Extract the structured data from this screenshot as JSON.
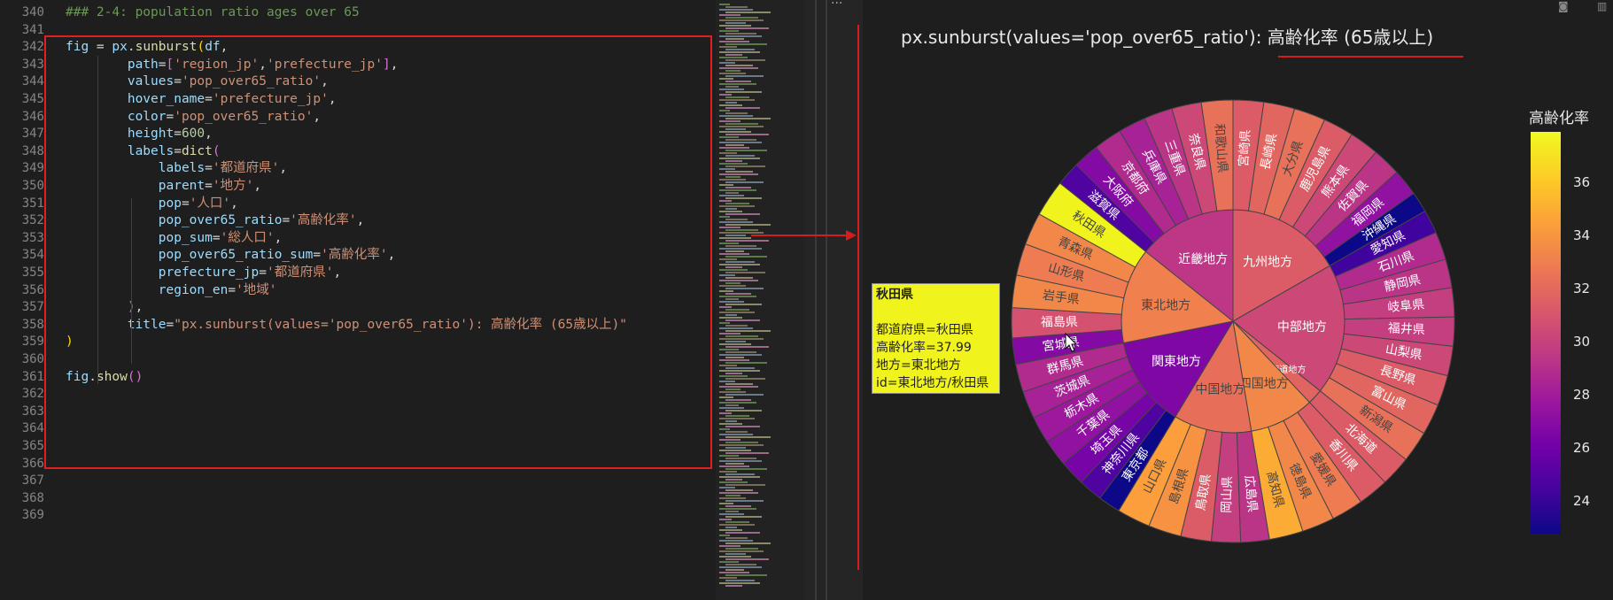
{
  "editor": {
    "line_numbers": [
      "340",
      "341",
      "342",
      "343",
      "344",
      "345",
      "346",
      "347",
      "348",
      "349",
      "350",
      "351",
      "352",
      "353",
      "354",
      "355",
      "356",
      "357",
      "358",
      "359",
      "360",
      "361",
      "362",
      "363",
      "364",
      "365",
      "366",
      "367",
      "368",
      "369"
    ],
    "lines": [
      [
        {
          "t": "### 2-4: population ratio ages over 65",
          "c": "com"
        }
      ],
      [],
      [
        {
          "t": "fig",
          "c": "var"
        },
        {
          "t": " = ",
          "c": "punc"
        },
        {
          "t": "px",
          "c": "var"
        },
        {
          "t": ".",
          "c": "punc"
        },
        {
          "t": "sunburst",
          "c": "fn"
        },
        {
          "t": "(",
          "c": "b1"
        },
        {
          "t": "df",
          "c": "var"
        },
        {
          "t": ",",
          "c": "punc"
        }
      ],
      [
        {
          "t": "        path",
          "c": "var"
        },
        {
          "t": "=",
          "c": "punc"
        },
        {
          "t": "[",
          "c": "b2"
        },
        {
          "t": "'region_jp'",
          "c": "str"
        },
        {
          "t": ",",
          "c": "punc"
        },
        {
          "t": "'prefecture_jp'",
          "c": "str"
        },
        {
          "t": "]",
          "c": "b2"
        },
        {
          "t": ",",
          "c": "punc"
        }
      ],
      [
        {
          "t": "        values",
          "c": "var"
        },
        {
          "t": "=",
          "c": "punc"
        },
        {
          "t": "'pop_over65_ratio'",
          "c": "str"
        },
        {
          "t": ",",
          "c": "punc"
        }
      ],
      [
        {
          "t": "        hover_name",
          "c": "var"
        },
        {
          "t": "=",
          "c": "punc"
        },
        {
          "t": "'prefecture_jp'",
          "c": "str"
        },
        {
          "t": ",",
          "c": "punc"
        }
      ],
      [
        {
          "t": "        color",
          "c": "var"
        },
        {
          "t": "=",
          "c": "punc"
        },
        {
          "t": "'pop_over65_ratio'",
          "c": "str"
        },
        {
          "t": ",",
          "c": "punc"
        }
      ],
      [
        {
          "t": "        height",
          "c": "var"
        },
        {
          "t": "=",
          "c": "punc"
        },
        {
          "t": "600",
          "c": "num"
        },
        {
          "t": ",",
          "c": "punc"
        }
      ],
      [
        {
          "t": "        labels",
          "c": "var"
        },
        {
          "t": "=",
          "c": "punc"
        },
        {
          "t": "dict",
          "c": "fn"
        },
        {
          "t": "(",
          "c": "b2"
        }
      ],
      [
        {
          "t": "            labels",
          "c": "var"
        },
        {
          "t": "=",
          "c": "punc"
        },
        {
          "t": "'都道府県'",
          "c": "str"
        },
        {
          "t": ",",
          "c": "punc"
        }
      ],
      [
        {
          "t": "            parent",
          "c": "var"
        },
        {
          "t": "=",
          "c": "punc"
        },
        {
          "t": "'地方'",
          "c": "str"
        },
        {
          "t": ",",
          "c": "punc"
        }
      ],
      [
        {
          "t": "            pop",
          "c": "var"
        },
        {
          "t": "=",
          "c": "punc"
        },
        {
          "t": "'人口'",
          "c": "str"
        },
        {
          "t": ",",
          "c": "punc"
        }
      ],
      [
        {
          "t": "            pop_over65_ratio",
          "c": "var"
        },
        {
          "t": "=",
          "c": "punc"
        },
        {
          "t": "'高齢化率'",
          "c": "str"
        },
        {
          "t": ",",
          "c": "punc"
        }
      ],
      [
        {
          "t": "            pop_sum",
          "c": "var"
        },
        {
          "t": "=",
          "c": "punc"
        },
        {
          "t": "'総人口'",
          "c": "str"
        },
        {
          "t": ",",
          "c": "punc"
        }
      ],
      [
        {
          "t": "            pop_over65_ratio_sum",
          "c": "var"
        },
        {
          "t": "=",
          "c": "punc"
        },
        {
          "t": "'高齢化率'",
          "c": "str"
        },
        {
          "t": ",",
          "c": "punc"
        }
      ],
      [
        {
          "t": "            prefecture_jp",
          "c": "var"
        },
        {
          "t": "=",
          "c": "punc"
        },
        {
          "t": "'都道府県'",
          "c": "str"
        },
        {
          "t": ",",
          "c": "punc"
        }
      ],
      [
        {
          "t": "            region_en",
          "c": "var"
        },
        {
          "t": "=",
          "c": "punc"
        },
        {
          "t": "'地域'",
          "c": "str"
        }
      ],
      [
        {
          "t": "        ",
          "c": "punc"
        },
        {
          "t": ")",
          "c": "b2"
        },
        {
          "t": ",",
          "c": "punc"
        }
      ],
      [
        {
          "t": "        title",
          "c": "var"
        },
        {
          "t": "=",
          "c": "punc"
        },
        {
          "t": "\"px.sunburst(values='pop_over65_ratio'): 高齢化率 (65歳以上)\"",
          "c": "str"
        }
      ],
      [
        {
          "t": ")",
          "c": "b1"
        }
      ],
      [],
      [
        {
          "t": "fig",
          "c": "var"
        },
        {
          "t": ".",
          "c": "punc"
        },
        {
          "t": "show",
          "c": "fn"
        },
        {
          "t": "()",
          "c": "b2"
        }
      ],
      [],
      [],
      [],
      [],
      [],
      [],
      [],
      []
    ]
  },
  "chart": {
    "title": "px.sunburst(values='pop_over65_ratio'): 高齢化率 (65歳以上)",
    "colorbar_title": "高齢化率",
    "colorbar_ticks": [
      "36",
      "34",
      "32",
      "30",
      "28",
      "26",
      "24"
    ],
    "tooltip": {
      "head": "秋田県",
      "lines": [
        "都道府県=秋田県",
        "高齢化率=37.99",
        "地方=東北地方",
        "id=東北地方/秋田県"
      ]
    },
    "colors": {
      "highlight": "#f0f31c",
      "low": "#0d0887",
      "high": "#f0f921"
    }
  },
  "chart_data": {
    "type": "sunburst",
    "title": "px.sunburst(values='pop_over65_ratio'): 高齢化率 (65歳以上)",
    "colorbar": {
      "title": "高齢化率",
      "range": [
        23,
        38
      ],
      "ticks": [
        24,
        26,
        28,
        30,
        32,
        34,
        36
      ]
    },
    "regions": [
      {
        "name": "九州地方",
        "value": 31.0,
        "color_value": 31.5
      },
      {
        "name": "中部地方",
        "value": 29.5,
        "color_value": 30.5
      },
      {
        "name": "北海道地方",
        "value": 3.0,
        "color_value": 31.9
      },
      {
        "name": "四国地方",
        "value": 13.0,
        "color_value": 33.5
      },
      {
        "name": "中国地方",
        "value": 18.0,
        "color_value": 32.4
      },
      {
        "name": "関東地方",
        "value": 13.0,
        "color_value": 26.8
      },
      {
        "name": "東北地方",
        "value": 20.0,
        "color_value": 33.2
      },
      {
        "name": "近畿地方",
        "value": 20.5,
        "color_value": 29.6
      }
    ],
    "prefectures": [
      {
        "name": "宮崎県",
        "region": "九州地方",
        "value": 31.5
      },
      {
        "name": "長崎県",
        "region": "九州地方",
        "value": 32.0
      },
      {
        "name": "大分県",
        "region": "九州地方",
        "value": 32.5
      },
      {
        "name": "鹿児島県",
        "region": "九州地方",
        "value": 31.5
      },
      {
        "name": "熊本県",
        "region": "九州地方",
        "value": 30.5
      },
      {
        "name": "佐賀県",
        "region": "九州地方",
        "value": 29.5
      },
      {
        "name": "福岡県",
        "region": "九州地方",
        "value": 27.5
      },
      {
        "name": "沖縄県",
        "region": "九州地方",
        "value": 21.5
      },
      {
        "name": "愛知県",
        "region": "中部地方",
        "value": 24.5
      },
      {
        "name": "石川県",
        "region": "中部地方",
        "value": 29.0
      },
      {
        "name": "静岡県",
        "region": "中部地方",
        "value": 29.5
      },
      {
        "name": "岐阜県",
        "region": "中部地方",
        "value": 30.0
      },
      {
        "name": "福井県",
        "region": "中部地方",
        "value": 30.0
      },
      {
        "name": "山梨県",
        "region": "中部地方",
        "value": 30.5
      },
      {
        "name": "長野県",
        "region": "中部地方",
        "value": 31.5
      },
      {
        "name": "富山県",
        "region": "中部地方",
        "value": 32.0
      },
      {
        "name": "新潟県",
        "region": "中部地方",
        "value": 32.5
      },
      {
        "name": "北海道",
        "region": "北海道地方",
        "value": 31.5
      },
      {
        "name": "香川県",
        "region": "四国地方",
        "value": 31.5
      },
      {
        "name": "愛媛県",
        "region": "四国地方",
        "value": 33.0
      },
      {
        "name": "徳島県",
        "region": "四国地方",
        "value": 33.5
      },
      {
        "name": "高知県",
        "region": "四国地方",
        "value": 35.0
      },
      {
        "name": "広島県",
        "region": "中国地方",
        "value": 29.5
      },
      {
        "name": "岡山県",
        "region": "中国地方",
        "value": 30.0
      },
      {
        "name": "鳥取県",
        "region": "中国地方",
        "value": 31.5
      },
      {
        "name": "島根県",
        "region": "中国地方",
        "value": 34.0
      },
      {
        "name": "山口県",
        "region": "中国地方",
        "value": 34.5
      },
      {
        "name": "東京都",
        "region": "関東地方",
        "value": 23.0
      },
      {
        "name": "神奈川県",
        "region": "関東地方",
        "value": 25.0
      },
      {
        "name": "埼玉県",
        "region": "関東地方",
        "value": 26.5
      },
      {
        "name": "千葉県",
        "region": "関東地方",
        "value": 27.5
      },
      {
        "name": "栃木県",
        "region": "関東地方",
        "value": 28.0
      },
      {
        "name": "茨城県",
        "region": "関東地方",
        "value": 28.5
      },
      {
        "name": "群馬県",
        "region": "関東地方",
        "value": 29.0
      },
      {
        "name": "宮城県",
        "region": "東北地方",
        "value": 27.0
      },
      {
        "name": "福島県",
        "region": "東北地方",
        "value": 31.0
      },
      {
        "name": "岩手県",
        "region": "東北地方",
        "value": 33.5
      },
      {
        "name": "山形県",
        "region": "東北地方",
        "value": 33.0
      },
      {
        "name": "青森県",
        "region": "東北地方",
        "value": 33.5
      },
      {
        "name": "秋田県",
        "region": "東北地方",
        "value": 37.99
      },
      {
        "name": "滋賀県",
        "region": "近畿地方",
        "value": 25.0
      },
      {
        "name": "大阪府",
        "region": "近畿地方",
        "value": 27.0
      },
      {
        "name": "京都府",
        "region": "近畿地方",
        "value": 29.0
      },
      {
        "name": "兵庫県",
        "region": "近畿地方",
        "value": 28.5
      },
      {
        "name": "三重県",
        "region": "近畿地方",
        "value": 29.5
      },
      {
        "name": "奈良県",
        "region": "近畿地方",
        "value": 30.5
      },
      {
        "name": "和歌山県",
        "region": "近畿地方",
        "value": 32.5
      }
    ]
  }
}
